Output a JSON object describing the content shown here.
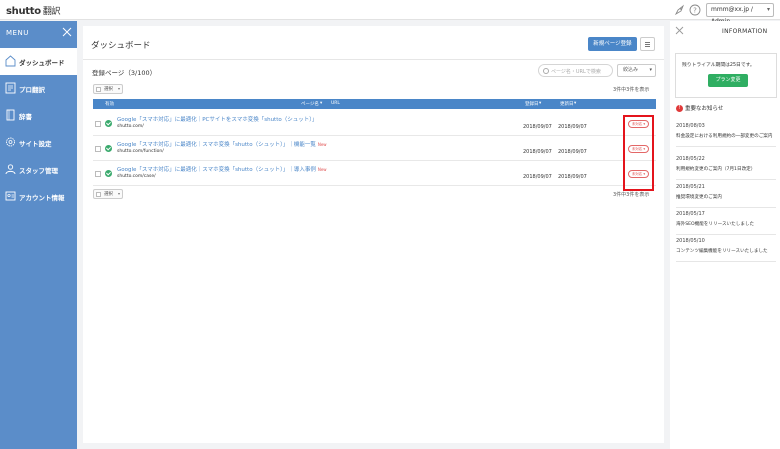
{
  "app": {
    "logo": "shutto",
    "logo_sub": "翻訳",
    "user_menu": "mmm@xx.jp / Admin"
  },
  "sidebar": {
    "menu_title": "MENU",
    "items": [
      {
        "label": "ダッシュボード",
        "icon": "home-icon",
        "active": true
      },
      {
        "label": "プロ翻訳",
        "icon": "pro-translation-icon"
      },
      {
        "label": "辞書",
        "icon": "dictionary-icon"
      },
      {
        "label": "サイト設定",
        "icon": "gear-icon"
      },
      {
        "label": "スタッフ管理",
        "icon": "staff-icon"
      },
      {
        "label": "アカウント情報",
        "icon": "account-icon"
      }
    ]
  },
  "main": {
    "title": "ダッシュボード",
    "new_page_button": "新規ページ登録",
    "registered_label": "登録ページ（3/100）",
    "search_placeholder": "ページ名・URLで検索",
    "filter_label": "絞込み",
    "select_label": "選択",
    "count_text": "3件中3件を表示",
    "table": {
      "headers": {
        "status": "有効",
        "page_name": "ページ名",
        "url": "URL",
        "registered": "登録日",
        "updated": "更新日"
      },
      "rows": [
        {
          "title": "Google「スマホ対応」に最適化｜PCサイトをスマホ変換「shutto（シュット）」",
          "is_new": false,
          "url": "shutto.com/",
          "registered": "2018/09/07",
          "updated": "2018/09/07",
          "tag": "未対応"
        },
        {
          "title": "Google「スマホ対応」に最適化｜スマホ変換「shutto（シュット）」｜機能一覧",
          "is_new": true,
          "new_label": "New",
          "url": "shutto.com/function/",
          "registered": "2018/09/07",
          "updated": "2018/09/07",
          "tag": "未対応"
        },
        {
          "title": "Google「スマホ対応」に最適化｜スマホ変換「shutto（シュット）」｜導入事例",
          "is_new": true,
          "new_label": "New",
          "url": "shutto.com/case/",
          "registered": "2018/09/07",
          "updated": "2018/09/07",
          "tag": "未対応"
        }
      ]
    }
  },
  "info_panel": {
    "title": "INFORMATION",
    "trial_text": "残りトライアル期間は25日です。",
    "plan_button": "プラン変更",
    "notice_heading": "重要なお知らせ",
    "news": [
      {
        "date": "2018/08/03",
        "text": "料金設定における利用規約の一部変更のご案内"
      },
      {
        "date": "2018/05/22",
        "text": "利用規約変更のご案内（7月1日改定）"
      },
      {
        "date": "2018/05/21",
        "text": "推奨環境変更のご案内"
      },
      {
        "date": "2018/05/17",
        "text": "海外SEO機能をリリースいたしました"
      },
      {
        "date": "2018/05/10",
        "text": "コンテンツ編集機能をリリースいたしました"
      }
    ]
  },
  "colors": {
    "sidebar": "#5b8dc9",
    "primary": "#4a86c8",
    "success": "#2fae62",
    "highlight": "#e4141c"
  }
}
